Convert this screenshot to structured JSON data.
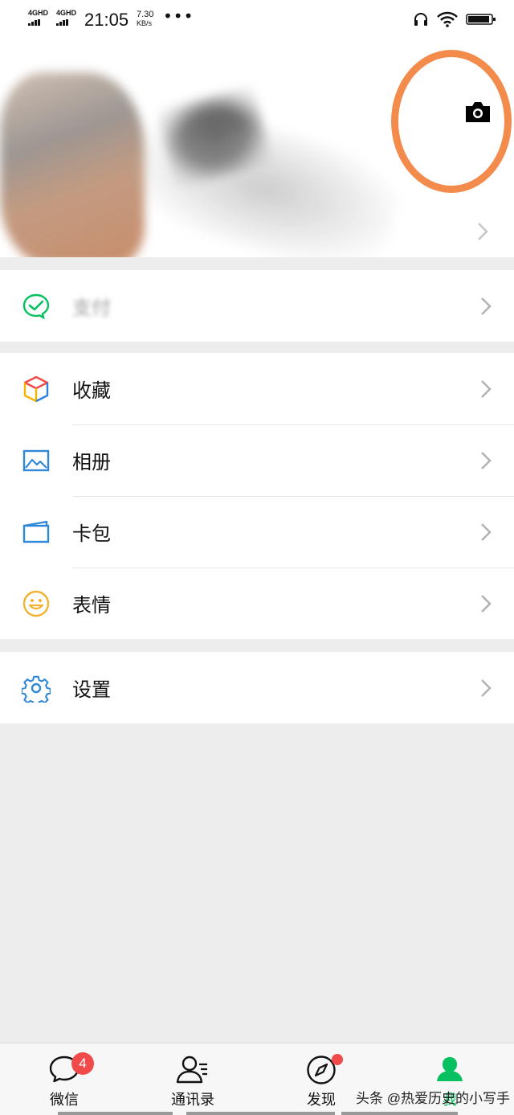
{
  "status_bar": {
    "network_1": "4GHD",
    "network_2": "4GHD",
    "time": "21:05",
    "speed_value": "7.30",
    "speed_unit": "KB/s",
    "more": "•••"
  },
  "menu": {
    "pay_label": "支付",
    "favorites_label": "收藏",
    "album_label": "相册",
    "cards_label": "卡包",
    "stickers_label": "表情",
    "settings_label": "设置"
  },
  "tabs": [
    {
      "label": "微信",
      "badge": "4"
    },
    {
      "label": "通讯录"
    },
    {
      "label": "发现"
    },
    {
      "label": "我"
    }
  ],
  "watermark": "头条 @热爱历史的小写手",
  "colors": {
    "wechat_green": "#07c160",
    "badge_red": "#f04a4a",
    "annotation_orange": "#f28b4b",
    "background": "#ededed"
  }
}
